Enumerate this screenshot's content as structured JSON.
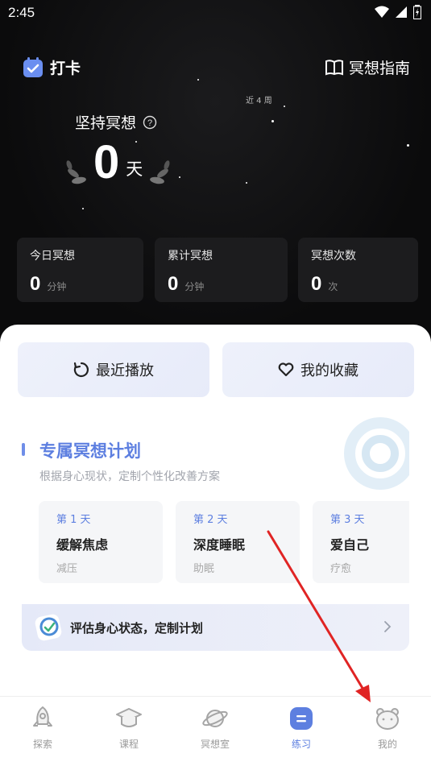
{
  "status_bar": {
    "time": "2:45"
  },
  "header": {
    "checkin_label": "打卡",
    "guide_label": "冥想指南"
  },
  "hero": {
    "weeks_label": "近 4 周",
    "persist_label": "坚持冥想",
    "days_value": "0",
    "days_unit": "天"
  },
  "stats": [
    {
      "title": "今日冥想",
      "value": "0",
      "unit": "分钟"
    },
    {
      "title": "累计冥想",
      "value": "0",
      "unit": "分钟"
    },
    {
      "title": "冥想次数",
      "value": "0",
      "unit": "次"
    }
  ],
  "quick": {
    "recent_label": "最近播放",
    "favorites_label": "我的收藏"
  },
  "plan": {
    "title": "专属冥想计划",
    "subtitle": "根据身心现状，定制个性化改善方案",
    "days": [
      {
        "no": "第 1 天",
        "name": "缓解焦虑",
        "tag": "减压"
      },
      {
        "no": "第 2 天",
        "name": "深度睡眠",
        "tag": "助眠"
      },
      {
        "no": "第 3 天",
        "name": "爱自己",
        "tag": "疗愈"
      }
    ],
    "assess_label": "评估身心状态，定制计划"
  },
  "tabs": [
    {
      "label": "探索"
    },
    {
      "label": "课程"
    },
    {
      "label": "冥想室"
    },
    {
      "label": "练习"
    },
    {
      "label": "我的"
    }
  ],
  "colors": {
    "accent": "#5d7fe0",
    "annotation_arrow": "#e02424"
  }
}
